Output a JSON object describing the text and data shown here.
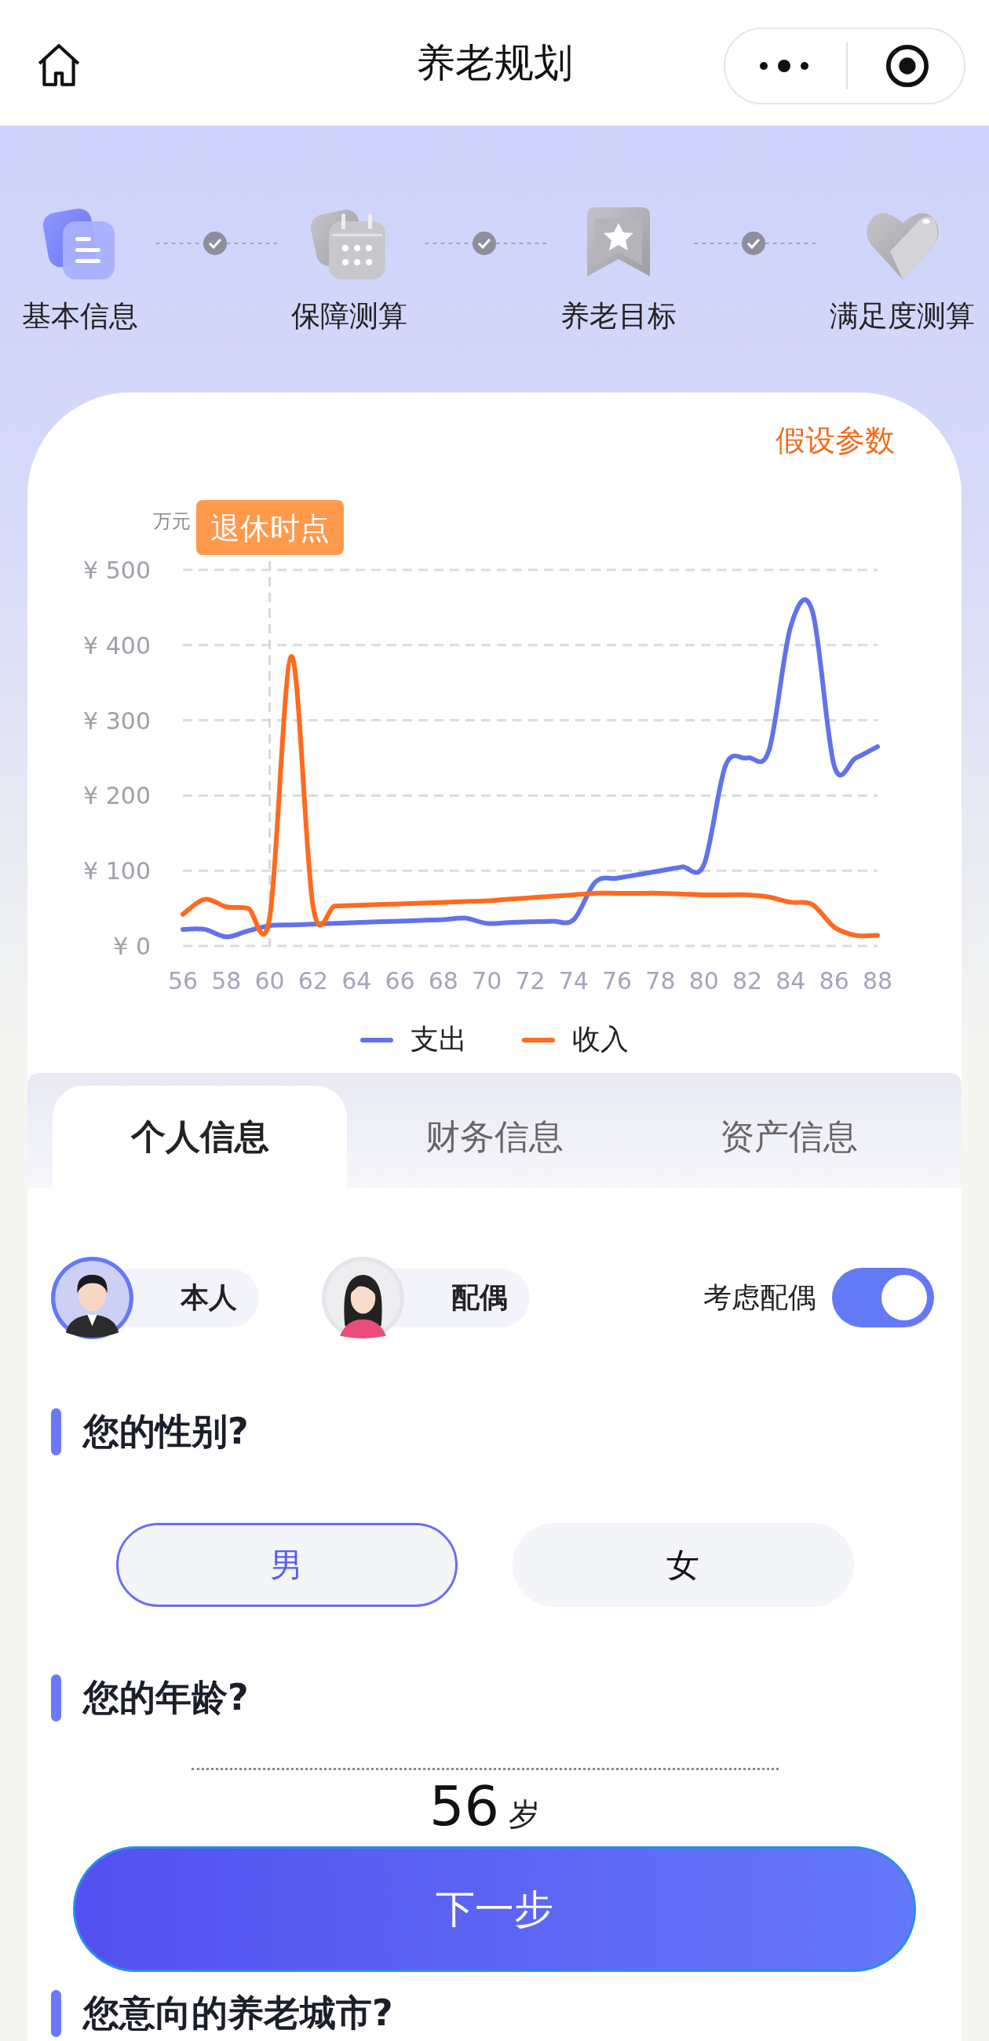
{
  "header": {
    "title": "养老规划"
  },
  "steps": [
    {
      "label": "基本信息",
      "kind": "document",
      "active": true
    },
    {
      "label": "保障测算",
      "kind": "calendar",
      "active": false
    },
    {
      "label": "养老目标",
      "kind": "bookmark",
      "active": false
    },
    {
      "label": "满足度测算",
      "kind": "heart",
      "active": false
    }
  ],
  "card": {
    "assumptions_link": "假设参数",
    "chart_data": {
      "type": "line",
      "ylabel": "万元",
      "x": [
        56,
        57,
        58,
        59,
        60,
        61,
        62,
        63,
        64,
        65,
        66,
        67,
        68,
        69,
        70,
        71,
        72,
        73,
        74,
        75,
        76,
        77,
        78,
        79,
        80,
        81,
        82,
        83,
        84,
        85,
        86,
        87,
        88
      ],
      "series": [
        {
          "name": "支出",
          "color": "#6272ec",
          "values": [
            22,
            22,
            12,
            20,
            27,
            28,
            29,
            30,
            31,
            32,
            33,
            34,
            35,
            37,
            30,
            31,
            32,
            33,
            35,
            85,
            90,
            95,
            100,
            105,
            108,
            240,
            250,
            260,
            425,
            445,
            240,
            250,
            265
          ]
        },
        {
          "name": "收入",
          "color": "#ff6a1f",
          "values": [
            42,
            62,
            52,
            50,
            38,
            385,
            52,
            53,
            54,
            55,
            56,
            57,
            58,
            59,
            60,
            62,
            64,
            66,
            68,
            70,
            70,
            70,
            70,
            69,
            68,
            68,
            68,
            65,
            58,
            55,
            25,
            14,
            14
          ]
        }
      ],
      "xlim": [
        56,
        88
      ],
      "ylim": [
        0,
        500
      ],
      "xticks": [
        56,
        58,
        60,
        62,
        64,
        66,
        68,
        70,
        72,
        74,
        76,
        78,
        80,
        82,
        84,
        86,
        88
      ],
      "yticks": [
        {
          "value": 0,
          "label": "¥ 0"
        },
        {
          "value": 100,
          "label": "¥ 100"
        },
        {
          "value": 200,
          "label": "¥ 200"
        },
        {
          "value": 300,
          "label": "¥ 300"
        },
        {
          "value": 400,
          "label": "¥ 400"
        },
        {
          "value": 500,
          "label": "¥ 500"
        }
      ],
      "grid": true,
      "ref_lines": [
        {
          "axis": "x",
          "value": 60
        }
      ],
      "annotations": [
        "退休时点"
      ]
    }
  },
  "tabs": [
    {
      "label": "个人信息",
      "selected": true
    },
    {
      "label": "财务信息",
      "selected": false
    },
    {
      "label": "资产信息",
      "selected": false
    }
  ],
  "persons": [
    {
      "label": "本人",
      "kind": "male",
      "selected": true
    },
    {
      "label": "配偶",
      "kind": "female",
      "selected": false
    }
  ],
  "consider_spouse": {
    "label": "考虑配偶",
    "on": true
  },
  "questions": [
    {
      "title": "您的性别?",
      "kind": "choice",
      "options": [
        {
          "label": "男",
          "selected": true
        },
        {
          "label": "女",
          "selected": false
        }
      ]
    },
    {
      "title": "您的年龄?",
      "kind": "picker",
      "value": "56",
      "unit": "岁"
    },
    {
      "title": "您意向的养老城市?",
      "kind": "heading"
    }
  ],
  "next_button": "下一步"
}
